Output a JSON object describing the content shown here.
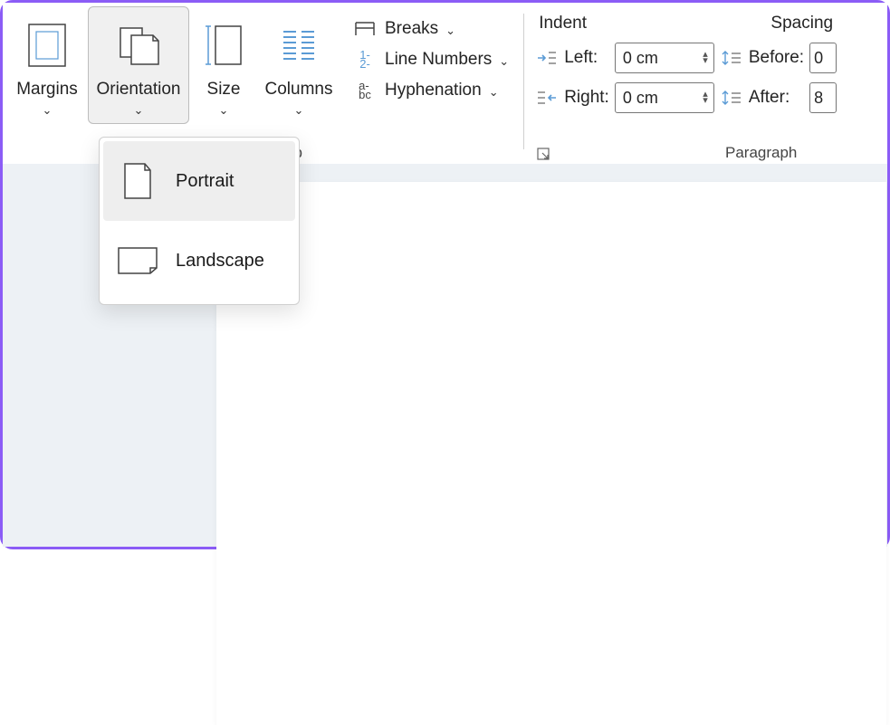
{
  "ribbon": {
    "page_setup": {
      "margins": "Margins",
      "orientation": "Orientation",
      "size": "Size",
      "columns": "Columns",
      "breaks": "Breaks",
      "line_numbers": "Line Numbers",
      "hyphenation": "Hyphenation",
      "group_suffix": "up"
    },
    "paragraph": {
      "group_label": "Paragraph",
      "indent_label": "Indent",
      "spacing_label": "Spacing",
      "left_label": "Left:",
      "right_label": "Right:",
      "before_label": "Before:",
      "after_label": "After:",
      "left_value": "0 cm",
      "right_value": "0 cm",
      "before_value": "0",
      "after_value": "8"
    }
  },
  "orientation_menu": {
    "portrait": "Portrait",
    "landscape": "Landscape"
  }
}
